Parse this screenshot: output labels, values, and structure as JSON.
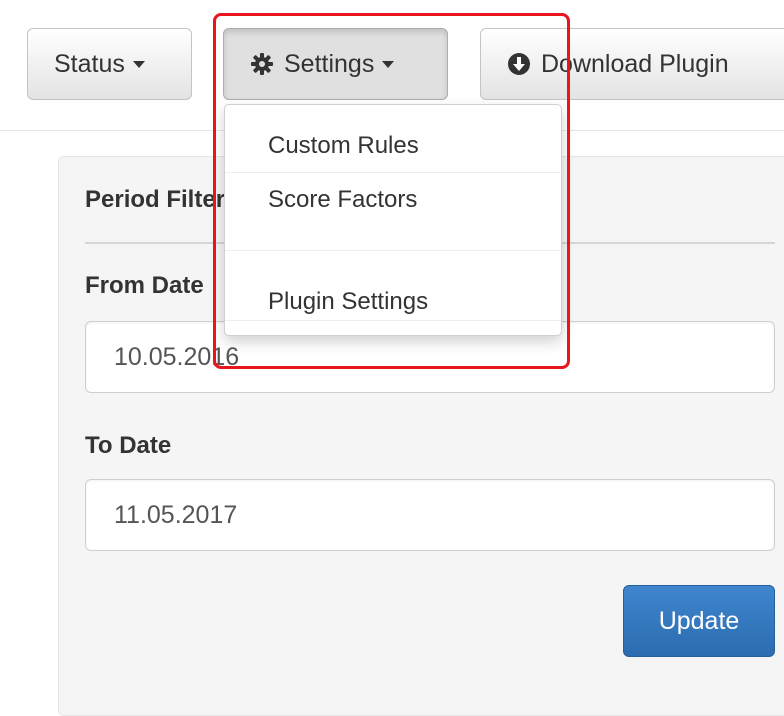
{
  "toolbar": {
    "status_label": "Status",
    "settings_label": "Settings",
    "download_label": "Download Plugin"
  },
  "settings_menu": {
    "items": [
      {
        "label": "Custom Rules"
      },
      {
        "label": "Score Factors"
      },
      {
        "label": ""
      },
      {
        "label": "Plugin Settings"
      }
    ]
  },
  "panel": {
    "title": "Period Filter",
    "from_label": "From Date",
    "from_value": "10.05.2016",
    "to_label": "To Date",
    "to_value": "11.05.2017",
    "update_label": "Update"
  },
  "icons": {
    "settings": "gear-icon",
    "download": "download-circle-icon",
    "caret": "caret-down-icon"
  },
  "colors": {
    "primary": "#337ab7",
    "highlight": "#e8141e"
  }
}
